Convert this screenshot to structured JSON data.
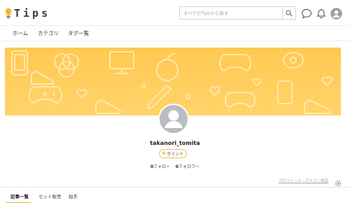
{
  "brand": {
    "name": "Tips",
    "icon": "lightbulb-icon",
    "accent": "#f0b429"
  },
  "search": {
    "placeholder": "すべてのTipsから探す",
    "button_icon": "search-icon"
  },
  "header_icons": [
    "chat-bubble-icon",
    "bell-icon",
    "user-avatar-icon"
  ],
  "nav": {
    "items": [
      {
        "label": "ホーム"
      },
      {
        "label": "カテゴリ"
      },
      {
        "label": "タグ一覧"
      }
    ]
  },
  "cover": {
    "background": "#ffc852",
    "pattern_color": "#ffe7a8"
  },
  "profile": {
    "username": "takanori_tomita",
    "points_value": "0",
    "points_label": "ポイント",
    "followers_count": "0",
    "followers_label": "フォロワー",
    "following_count": "0",
    "following_label": "フォロー",
    "settings_link": "プロフィール・アイコン設定"
  },
  "tabs": {
    "items": [
      {
        "label": "記事一覧"
      },
      {
        "label": "セット販売"
      },
      {
        "label": "拍手"
      }
    ],
    "active": "記事一覧"
  }
}
